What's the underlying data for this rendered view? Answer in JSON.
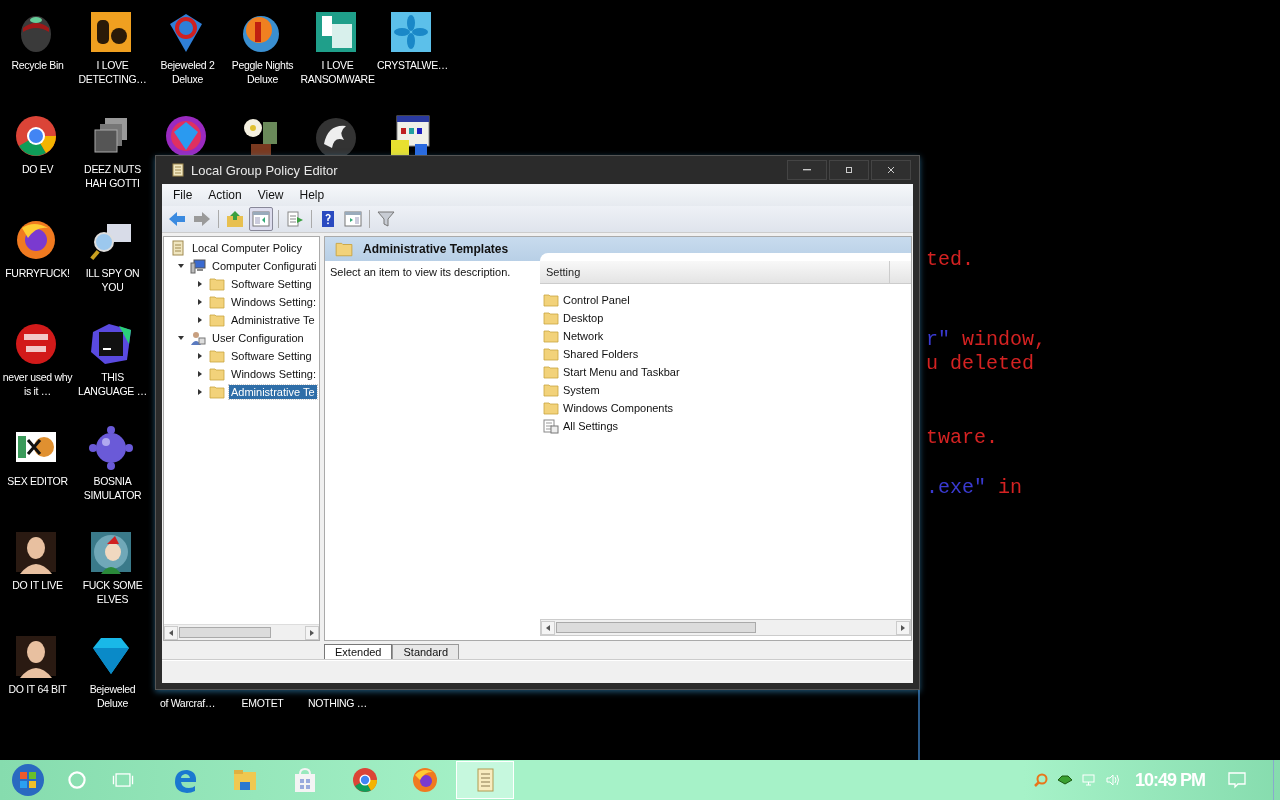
{
  "desktop": {
    "icons": [
      {
        "label": "Recycle Bin"
      },
      {
        "label": "I LOVE DETECTING…"
      },
      {
        "label": "Bejeweled 2 Deluxe"
      },
      {
        "label": "Peggle Nights Deluxe"
      },
      {
        "label": "I LOVE RANSOMWARE"
      },
      {
        "label": "CRYSTALWE…"
      },
      {
        "label": "DO EV"
      },
      {
        "label": "DEEZ NUTS HAH GOTTI"
      },
      {
        "label": "FURRYFUCK!"
      },
      {
        "label": "ILL SPY ON YOU"
      },
      {
        "label": "never used why is it …"
      },
      {
        "label": "THIS LANGUAGE …"
      },
      {
        "label": "SEX EDITOR"
      },
      {
        "label": "BOSNIA SIMULATOR"
      },
      {
        "label": "DO IT LIVE"
      },
      {
        "label": "FUCK SOME ELVES"
      },
      {
        "label": "DO IT 64 BIT"
      },
      {
        "label": "Bejeweled Deluxe"
      }
    ],
    "cut_labels": [
      "of Warcraf…",
      "EMOTET",
      "NOTHING …"
    ]
  },
  "console": {
    "lines": [
      {
        "segments": [
          {
            "text": "ted.",
            "color": "#d42222"
          }
        ]
      },
      {
        "segments": [
          {
            "text": "r\"",
            "color": "#3a3ad0"
          },
          {
            "text": " window,",
            "color": "#d42222"
          }
        ]
      },
      {
        "segments": [
          {
            "text": "u deleted",
            "color": "#d42222"
          }
        ]
      },
      {
        "segments": [
          {
            "text": "tware.",
            "color": "#d42222"
          }
        ]
      },
      {
        "segments": [
          {
            "text": ".exe\"",
            "color": "#3a3ad0"
          },
          {
            "text": " in",
            "color": "#d42222"
          }
        ]
      }
    ]
  },
  "window": {
    "title": "Local Group Policy Editor",
    "menu": [
      "File",
      "Action",
      "View",
      "Help"
    ],
    "tree": {
      "label": "Local Computer Policy",
      "kind": "policy",
      "selected": false,
      "children": [
        {
          "label": "Computer Configurati",
          "kind": "computer",
          "expanded": true,
          "selected": false,
          "children": [
            {
              "label": "Software Setting",
              "kind": "folder",
              "expanded": false,
              "selected": false
            },
            {
              "label": "Windows Setting:",
              "kind": "folder",
              "expanded": false,
              "selected": false
            },
            {
              "label": "Administrative Te",
              "kind": "folder",
              "expanded": false,
              "selected": false
            }
          ]
        },
        {
          "label": "User Configuration",
          "kind": "user",
          "expanded": true,
          "selected": false,
          "children": [
            {
              "label": "Software Setting",
              "kind": "folder",
              "expanded": false,
              "selected": false
            },
            {
              "label": "Windows Setting:",
              "kind": "folder",
              "expanded": false,
              "selected": false
            },
            {
              "label": "Administrative Te",
              "kind": "folder",
              "expanded": false,
              "selected": true
            }
          ]
        }
      ]
    },
    "details": {
      "heading": "Administrative Templates",
      "description": "Select an item to view its description.",
      "column": "Setting",
      "items": [
        {
          "label": "Control Panel",
          "kind": "folder"
        },
        {
          "label": "Desktop",
          "kind": "folder"
        },
        {
          "label": "Network",
          "kind": "folder"
        },
        {
          "label": "Shared Folders",
          "kind": "folder"
        },
        {
          "label": "Start Menu and Taskbar",
          "kind": "folder"
        },
        {
          "label": "System",
          "kind": "folder"
        },
        {
          "label": "Windows Components",
          "kind": "folder"
        },
        {
          "label": "All Settings",
          "kind": "settings"
        }
      ]
    },
    "tabs": [
      {
        "label": "Extended",
        "selected": true
      },
      {
        "label": "Standard",
        "selected": false
      }
    ]
  },
  "taskbar": {
    "apps": [
      {
        "kind": "edge",
        "selected": false
      },
      {
        "kind": "folder",
        "selected": false
      },
      {
        "kind": "store",
        "selected": false
      },
      {
        "kind": "chrome",
        "selected": false
      },
      {
        "kind": "firefox",
        "selected": false
      },
      {
        "kind": "scroll",
        "selected": true
      }
    ],
    "clock": "10:49 PM"
  }
}
